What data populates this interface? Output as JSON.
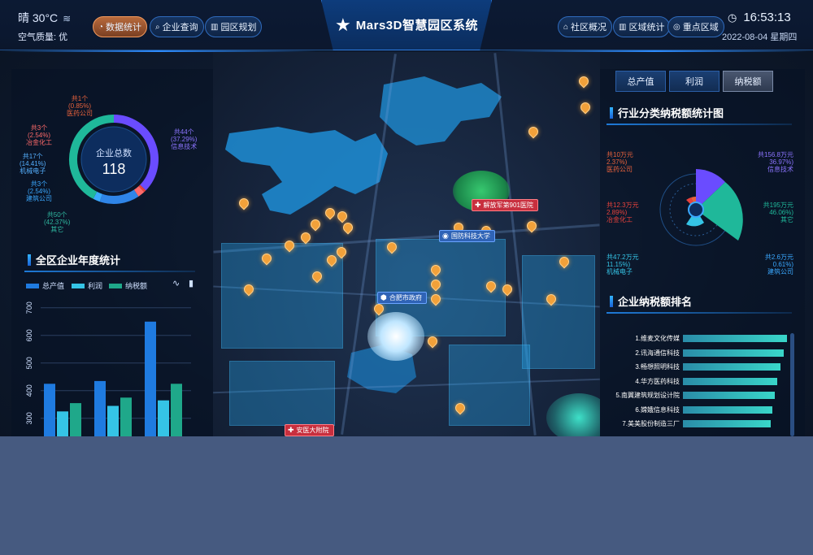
{
  "header": {
    "weather": "晴 30°C",
    "air_quality": "空气质量:  优",
    "nav_left": [
      {
        "label": "数据统计",
        "icon": "pie-chart-icon",
        "active": true
      },
      {
        "label": "企业查询",
        "icon": "search-doc-icon",
        "active": false
      },
      {
        "label": "园区规划",
        "icon": "book-icon",
        "active": false
      }
    ],
    "nav_right": [
      {
        "label": "社区概况",
        "icon": "community-icon"
      },
      {
        "label": "区域统计",
        "icon": "book-icon"
      },
      {
        "label": "重点区域",
        "icon": "location-icon"
      }
    ],
    "title": "Mars3D智慧园区系统",
    "time": "16:53:13",
    "date": "2022-08-04 星期四"
  },
  "left_panel": {
    "donut": {
      "center_label": "企业总数",
      "center_value": "118",
      "segments": [
        {
          "name": "信息技术",
          "count_text": "共44个",
          "percent_text": "(37.29%)",
          "value": 37.29,
          "color": "#6a4cff"
        },
        {
          "name": "医药公司",
          "count_text": "共1个",
          "percent_text": "(0.85%)",
          "value": 0.85,
          "color": "#e8423c"
        },
        {
          "name": "冶金化工",
          "count_text": "共3个",
          "percent_text": "(2.54%)",
          "value": 2.54,
          "color": "#ff6a6a"
        },
        {
          "name": "机械电子",
          "count_text": "共17个",
          "percent_text": "(14.41%)",
          "value": 14.41,
          "color": "#2f85e8"
        },
        {
          "name": "建筑公司",
          "count_text": "共3个",
          "percent_text": "(2.54%)",
          "value": 2.54,
          "color": "#3aa8ff"
        },
        {
          "name": "其它",
          "count_text": "共50个",
          "percent_text": "(42.37%)",
          "value": 42.37,
          "color": "#1fb89a"
        }
      ]
    },
    "annual_title": "全区企业年度统计",
    "legend": [
      {
        "label": "总产值",
        "color": "#1f7be0"
      },
      {
        "label": "利润",
        "color": "#35c4e6"
      },
      {
        "label": "纳税额",
        "color": "#1fa88a"
      }
    ],
    "chart_icons": [
      "line-chart-icon",
      "bar-chart-icon"
    ]
  },
  "chart_data": {
    "type": "bar",
    "title": "全区企业年度统计",
    "ylim": [
      250,
      720
    ],
    "yticks": [
      "700",
      "600",
      "500",
      "400",
      "300"
    ],
    "series": [
      {
        "name": "总产值",
        "values": [
          425,
          435,
          650
        ]
      },
      {
        "name": "利润",
        "values": [
          325,
          345,
          365
        ]
      },
      {
        "name": "纳税额",
        "values": [
          355,
          375,
          425
        ]
      }
    ]
  },
  "right_panel": {
    "tabs": [
      {
        "label": "总产值",
        "active": false
      },
      {
        "label": "利润",
        "active": false
      },
      {
        "label": "纳税额",
        "active": true
      }
    ],
    "industry_title": "行业分类纳税额统计图",
    "industry_labels": [
      {
        "line1": "共10万元",
        "line2": "2.37%)",
        "line3": "医药公司",
        "color": "#e8623c"
      },
      {
        "line1": "共12.3万元",
        "line2": "2.89%)",
        "line3": "冶金化工",
        "color": "#e8423c"
      },
      {
        "line1": "共47.2万元",
        "line2": "11.15%)",
        "line3": "机械电子",
        "color": "#35c4e6"
      },
      {
        "line1": "共156.8万元",
        "line2": "36.97%)",
        "line3": "信息技术",
        "color": "#6a4cff"
      },
      {
        "line1": "共195万元",
        "line2": "46.06%)",
        "line3": "其它",
        "color": "#1fb89a"
      },
      {
        "line1": "共2.6万元",
        "line2": "0.61%)",
        "line3": "建筑公司",
        "color": "#3aa8ff"
      }
    ],
    "rank_title": "企业纳税额排名",
    "rank": [
      {
        "label": "1.维麦文化传媒",
        "value": 100
      },
      {
        "label": "2.讯海通信科技",
        "value": 97
      },
      {
        "label": "3.畅想照明科技",
        "value": 94
      },
      {
        "label": "4.华方医药科技",
        "value": 91
      },
      {
        "label": "5.南翼建筑规划设计院",
        "value": 88
      },
      {
        "label": "6.嫦娥信息科技",
        "value": 86
      },
      {
        "label": "7.美美股份制造三厂",
        "value": 84
      }
    ]
  },
  "map": {
    "pois": [
      {
        "label": "解放军第901医院",
        "kind": "red",
        "icon": "hospital-icon"
      },
      {
        "label": "国防科技大学",
        "kind": "blue",
        "icon": "school-icon"
      },
      {
        "label": "合肥市政府",
        "kind": "blue",
        "icon": "government-icon"
      },
      {
        "label": "安医大附院",
        "kind": "red",
        "icon": "hospital-icon"
      }
    ]
  }
}
